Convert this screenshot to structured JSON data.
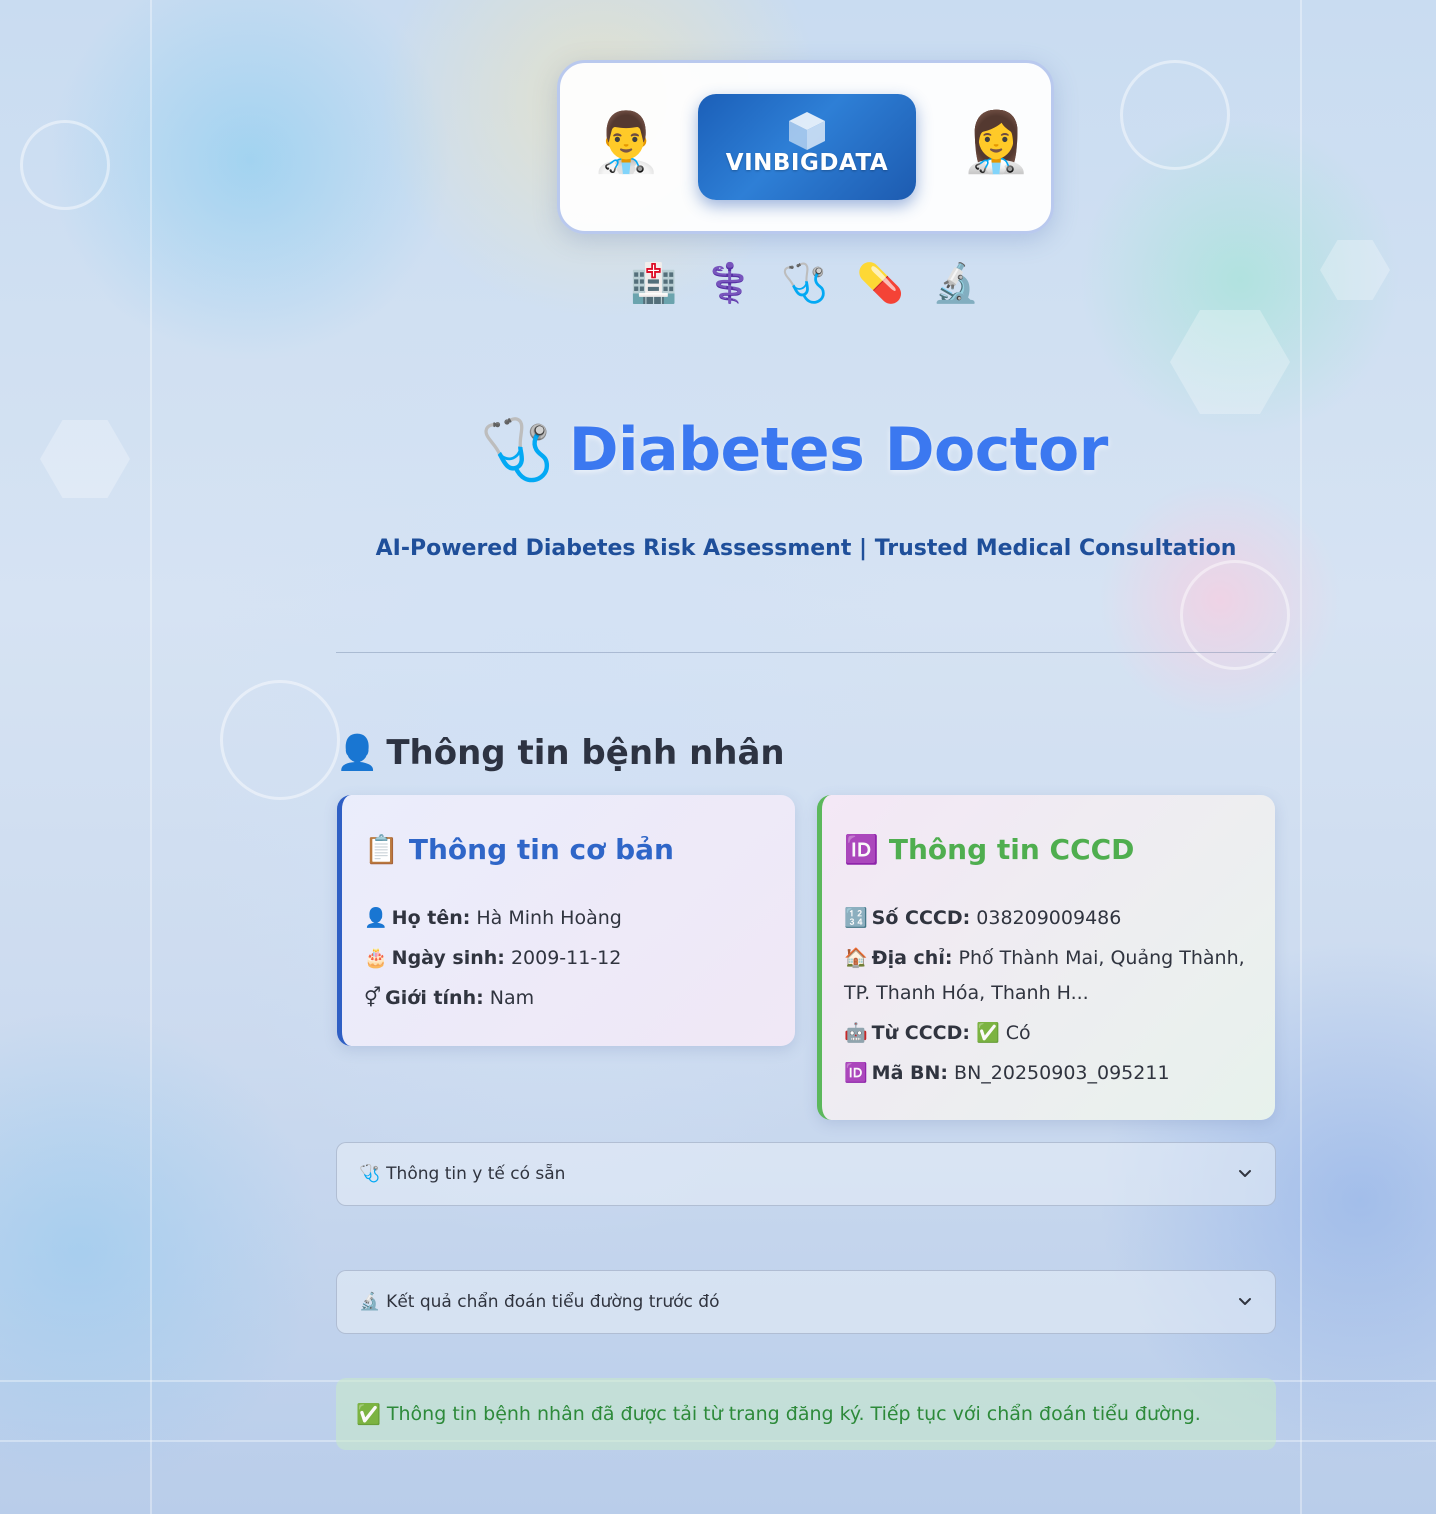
{
  "header": {
    "logo_emoji_left": "👨‍⚕️",
    "logo_emoji_right": "👩‍⚕️",
    "brand_name": "VINBIGDATA",
    "icons": [
      "🏥",
      "⚕️",
      "🩺",
      "💊",
      "🔬"
    ],
    "title_icon": "🩺",
    "title": "Diabetes Doctor",
    "subtitle": "AI-Powered Diabetes Risk Assessment | Trusted Medical Consultation"
  },
  "section": {
    "icon": "👤",
    "heading": "Thông tin bệnh nhân"
  },
  "basic_card": {
    "icon": "📋",
    "title": "Thông tin cơ bản",
    "rows": [
      {
        "icon": "👤",
        "label": "Họ tên:",
        "value": "Hà Minh Hoàng"
      },
      {
        "icon": "🎂",
        "label": "Ngày sinh:",
        "value": "2009-11-12"
      },
      {
        "icon": "⚥",
        "label": "Giới tính:",
        "value": "Nam"
      }
    ]
  },
  "cccd_card": {
    "icon": "🆔",
    "title": "Thông tin CCCD",
    "rows": [
      {
        "icon": "🔢",
        "label": "Số CCCD:",
        "value": "038209009486"
      },
      {
        "icon": "🏠",
        "label": "Địa chỉ:",
        "value": "Phố Thành Mai, Quảng Thành, TP. Thanh Hóa, Thanh H..."
      },
      {
        "icon": "🤖",
        "label": "Từ CCCD:",
        "value": "✅ Có"
      },
      {
        "icon": "🆔",
        "label": "Mã BN:",
        "value": "BN_20250903_095211"
      }
    ]
  },
  "expanders": {
    "medical": {
      "icon": "🩺",
      "label": "Thông tin y tế có sẵn"
    },
    "previous": {
      "icon": "🔬",
      "label": "Kết quả chẩn đoán tiểu đường trước đó"
    }
  },
  "alert": {
    "icon": "✅",
    "text": "Thông tin bệnh nhân đã được tải từ trang đăng ký. Tiếp tục với chẩn đoán tiểu đường."
  },
  "colors": {
    "title": "#3b78f0",
    "basic_accent": "#2f5fc4",
    "cccd_accent": "#5cb85c",
    "success_text": "#2d8a3a"
  }
}
